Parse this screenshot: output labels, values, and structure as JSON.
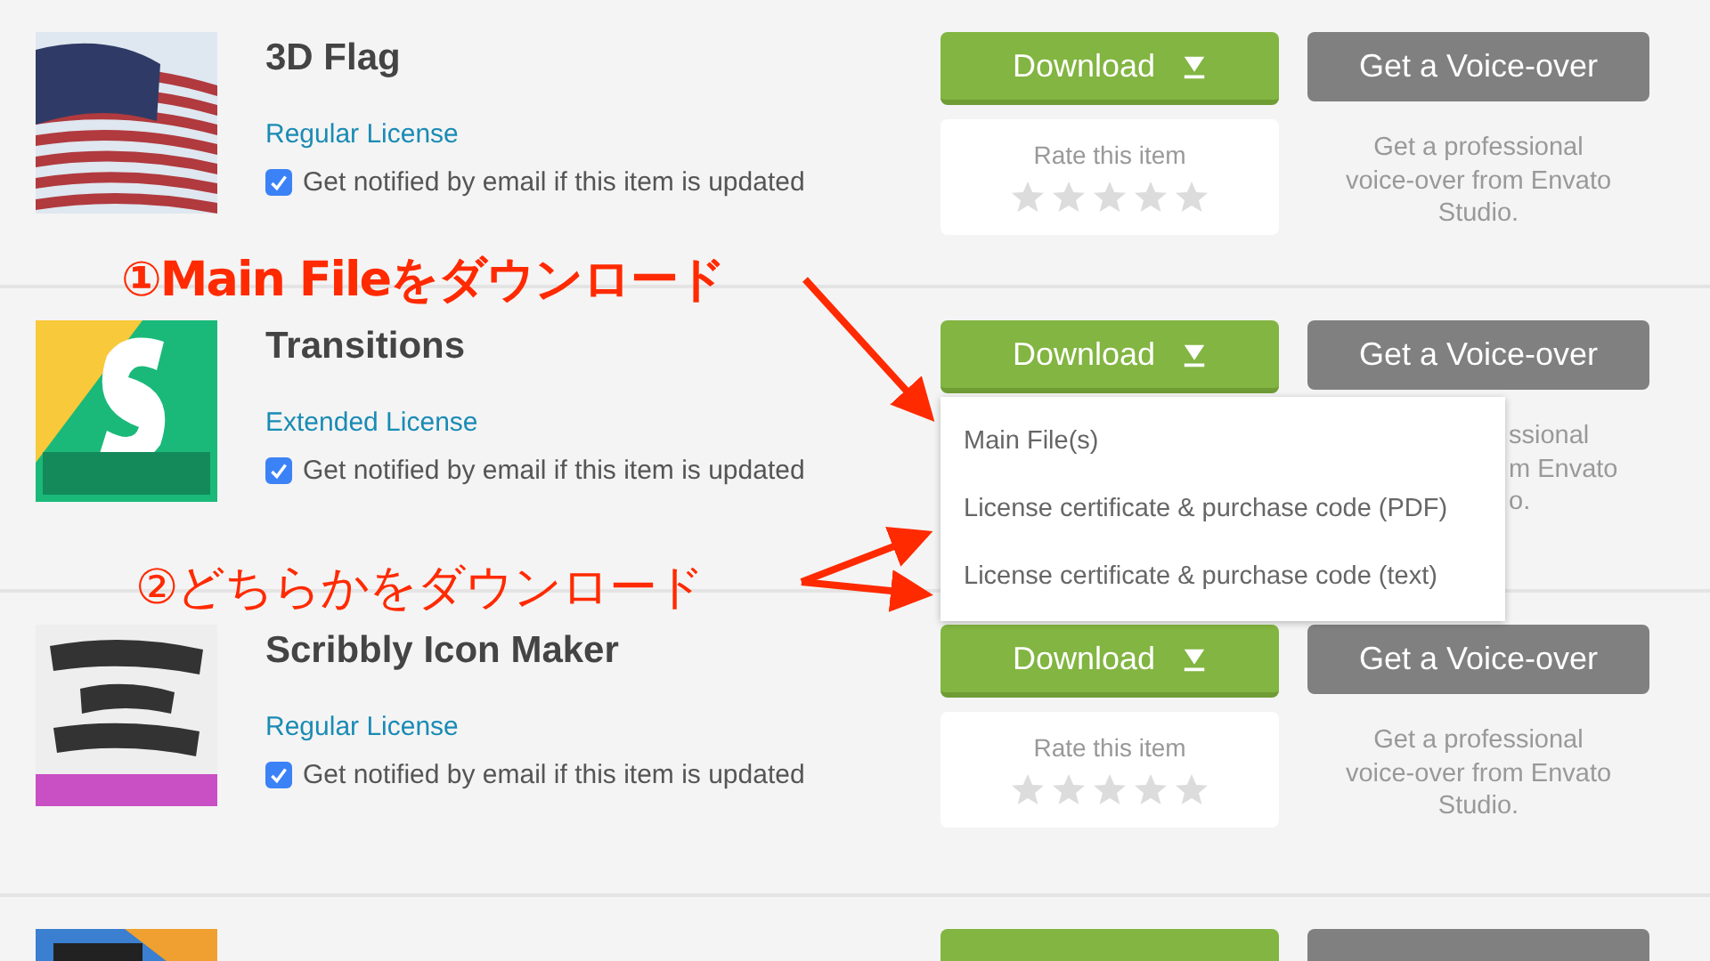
{
  "items": [
    {
      "thumb": {
        "kind": "picture"
      },
      "title": "3D Flag",
      "license": "Regular License",
      "notify": {
        "label": "Get notified by email if this item is updated",
        "checked": true
      },
      "download": "Download",
      "rating": {
        "label": "Rate this item",
        "stars": 0
      },
      "voice_over": "Get a Voice-over",
      "voice_note": [
        "Get a professional",
        "voice-over from Envato",
        "Studio."
      ]
    },
    {
      "thumb": {
        "kind": "picture"
      },
      "title": "Transitions",
      "license": "Extended License",
      "notify": {
        "label": "Get notified by email if this item is updated",
        "checked": true
      },
      "download": "Download",
      "voice_over": "Get a Voice-over",
      "voice_note_visible": [
        "ssional",
        "m Envato",
        "o."
      ],
      "menu": {
        "expanded": true,
        "options": [
          "Main File(s)",
          "License certificate & purchase code (PDF)",
          "License certificate & purchase code (text)"
        ]
      }
    },
    {
      "thumb": {
        "kind": "picture"
      },
      "title": "Scribbly Icon Maker",
      "license": "Regular License",
      "notify": {
        "label": "Get notified by email if this item is updated",
        "checked": true
      },
      "download": "Download",
      "rating": {
        "label": "Rate this item",
        "stars": 0
      },
      "voice_over": "Get a Voice-over",
      "voice_note": [
        "Get a professional",
        "voice-over from Envato",
        "Studio."
      ]
    },
    {
      "thumb": {
        "kind": "picture"
      }
    }
  ],
  "annotations": [
    {
      "text": "①Main Fileをダウンロード"
    },
    {
      "text": "②どちらかをダウンロード"
    }
  ]
}
